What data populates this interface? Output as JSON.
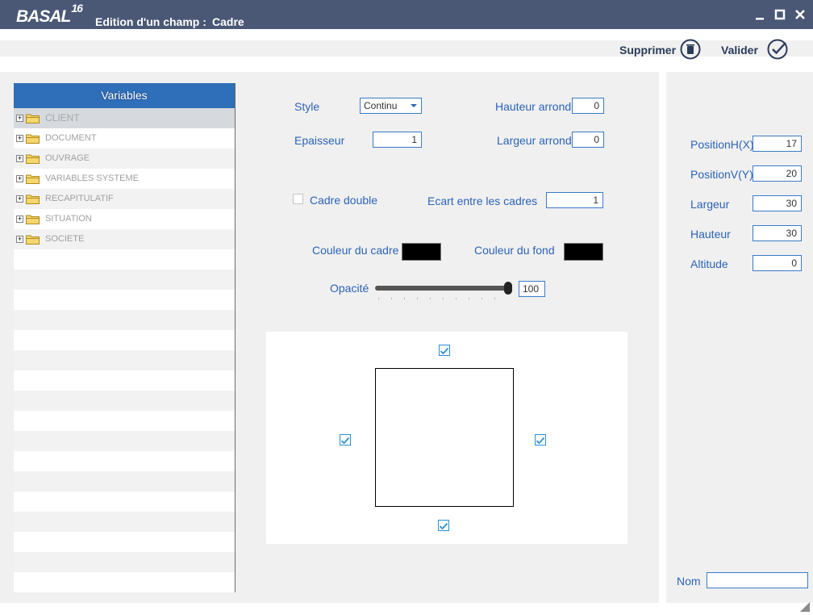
{
  "titlebar": {
    "logo_text": "BASAL",
    "logo_version": "16",
    "title": "Edition d'un champ :",
    "subtitle": "Cadre",
    "minimize_icon": "minimize-icon",
    "maximize_icon": "maximize-icon",
    "close_icon": "close-icon"
  },
  "toolbar": {
    "delete_label": "Supprimer",
    "delete_icon": "trash-icon",
    "validate_label": "Valider",
    "validate_icon": "checkmark-circle-icon"
  },
  "variables": {
    "header": "Variables",
    "items": [
      {
        "label": "CLIENT",
        "expander": "+"
      },
      {
        "label": "DOCUMENT",
        "expander": "+"
      },
      {
        "label": "OUVRAGE",
        "expander": "+"
      },
      {
        "label": "VARIABLES SYSTEME",
        "expander": "+"
      },
      {
        "label": "RECAPITULATIF",
        "expander": "+"
      },
      {
        "label": "SITUATION",
        "expander": "+"
      },
      {
        "label": "SOCIETE",
        "expander": "+"
      }
    ]
  },
  "form": {
    "style_label": "Style",
    "style_value": "Continu",
    "hauteur_arrondi_label": "Hauteur arrondi",
    "hauteur_arrondi_value": "0",
    "epaisseur_label": "Epaisseur",
    "epaisseur_value": "1",
    "largeur_arrondi_label": "Largeur arrondi",
    "largeur_arrondi_value": "0",
    "cadre_double_label": "Cadre double",
    "cadre_double_checked": false,
    "ecart_label": "Ecart entre les cadres",
    "ecart_value": "1",
    "couleur_cadre_label": "Couleur du cadre",
    "couleur_cadre_value": "#000000",
    "couleur_fond_label": "Couleur du fond",
    "couleur_fond_value": "#000000",
    "opacite_label": "Opacité",
    "opacite_value": "100"
  },
  "borders": {
    "top_checked": true,
    "left_checked": true,
    "right_checked": true,
    "bottom_checked": true
  },
  "position": {
    "x_label": "PositionH(X)",
    "x_value": "17",
    "y_label": "PositionV(Y)",
    "y_value": "20",
    "largeur_label": "Largeur",
    "largeur_value": "30",
    "hauteur_label": "Hauteur",
    "hauteur_value": "30",
    "altitude_label": "Altitude",
    "altitude_value": "0",
    "nom_label": "Nom",
    "nom_value": ""
  }
}
